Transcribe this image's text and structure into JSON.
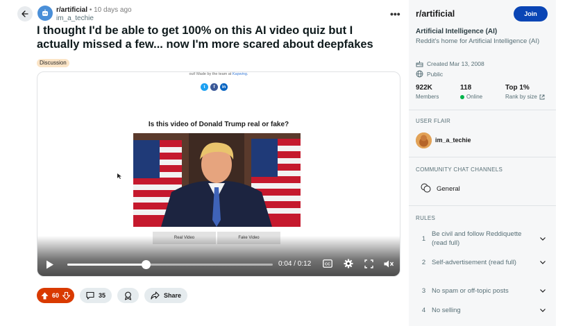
{
  "post": {
    "subreddit": "r/artificial",
    "separator": "•",
    "time": "10 days ago",
    "author": "im_a_techie",
    "more_label": "•••",
    "title": "I thought I'd be able to get 100% on this AI video quiz but I actually missed a few... now I'm more scared about deepfakes",
    "flair": "Discussion"
  },
  "media": {
    "credit_prefix": "out! Made by the team at ",
    "credit_link": "Kapwing",
    "credit_suffix": ".",
    "question": "Is this video of Donald Trump real or fake?",
    "real_label": "Real Video",
    "fake_label": "Fake Video",
    "time_readout": "0:04 / 0:12",
    "progress_fraction": 0.383
  },
  "actions": {
    "votes": "60",
    "comments": "35",
    "share": "Share"
  },
  "sidebar": {
    "name": "r/artificial",
    "join": "Join",
    "title": "Artificial Intelligence (AI)",
    "description": "Reddit's home for Artificial Intelligence (AI)",
    "created": "Created Mar 13, 2008",
    "visibility": "Public",
    "stats": [
      {
        "value": "922K",
        "label": "Members"
      },
      {
        "value": "118",
        "label": "Online"
      },
      {
        "value": "Top 1%",
        "label": "Rank by size"
      }
    ],
    "user_flair_heading": "USER FLAIR",
    "user_flair_name": "im_a_techie",
    "chat_heading": "COMMUNITY CHAT CHANNELS",
    "chat_channel": "General",
    "rules_heading": "RULES",
    "rules": [
      {
        "n": "1",
        "text": "Be civil and follow Reddiquette (read full)"
      },
      {
        "n": "2",
        "text": "Self-advertisement (read full)"
      },
      {
        "n": "3",
        "text": "No spam or off-topic posts"
      },
      {
        "n": "4",
        "text": "No selling"
      }
    ]
  },
  "colors": {
    "upvote_bg": "#d93a00",
    "join_bg": "#0a45b5",
    "flair_bg": "#fbe4c6",
    "online": "#00b34a"
  }
}
